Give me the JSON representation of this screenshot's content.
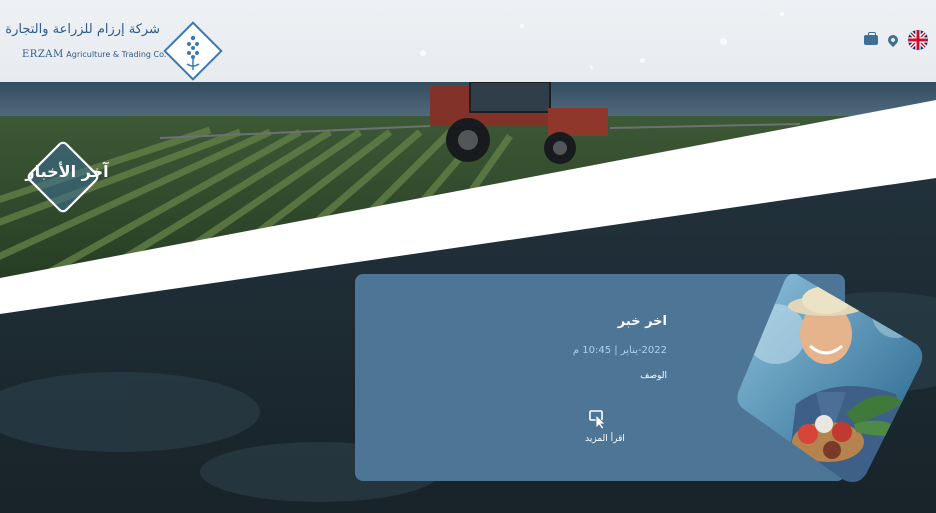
{
  "header": {
    "company_name_ar": "شركة إرزام للزراعة والتجارة",
    "company_name_en_brand": "ERZAM",
    "company_name_en_rest": "Agriculture & Trading Co.",
    "icons": [
      "briefcase-icon",
      "location-pin-icon",
      "uk-flag-icon"
    ]
  },
  "hero": {
    "section_badge": "آخر الأخبار"
  },
  "news_card": {
    "title": "اخر خبر",
    "date": "2022-يناير | 10:45 م",
    "description": "الوصف",
    "read_more": "اقرأ المزيد",
    "read_more_icon": "pointer-click-icon",
    "image": "farmer-with-vegetables"
  },
  "colors": {
    "header_bg": "#eef1f4",
    "brand_blue": "#3a79b3",
    "card_bg": "#4c7596",
    "date_text": "#a9d2f2",
    "dark_overlay": "#1e2d35"
  }
}
